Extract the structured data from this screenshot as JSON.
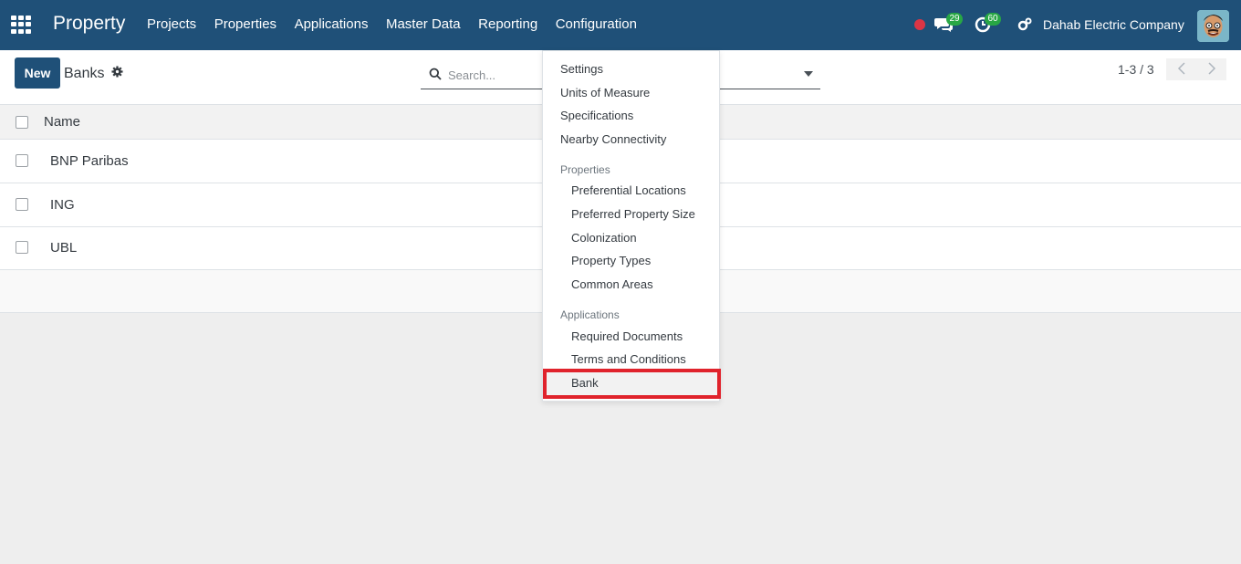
{
  "navbar": {
    "brand": "Property",
    "menu": [
      "Projects",
      "Properties",
      "Applications",
      "Master Data",
      "Reporting",
      "Configuration"
    ],
    "chat_count": "29",
    "activity_count": "60",
    "company": "Dahab Electric Company"
  },
  "control_panel": {
    "new_label": "New",
    "title": "Banks",
    "search_placeholder": "Search...",
    "pager": "1-3 / 3"
  },
  "list": {
    "column": "Name",
    "rows": [
      "BNP Paribas",
      "ING",
      "UBL"
    ]
  },
  "dropdown": {
    "top_items": [
      "Settings",
      "Units of Measure",
      "Specifications",
      "Nearby Connectivity"
    ],
    "properties_header": "Properties",
    "properties_items": [
      "Preferential Locations",
      "Preferred Property Size",
      "Colonization",
      "Property Types",
      "Common Areas"
    ],
    "applications_header": "Applications",
    "applications_items": [
      "Required Documents",
      "Terms and Conditions",
      "Bank"
    ]
  },
  "colors": {
    "navbar": "#1f5078",
    "highlight": "#e0232c",
    "badge": "#28a745"
  }
}
